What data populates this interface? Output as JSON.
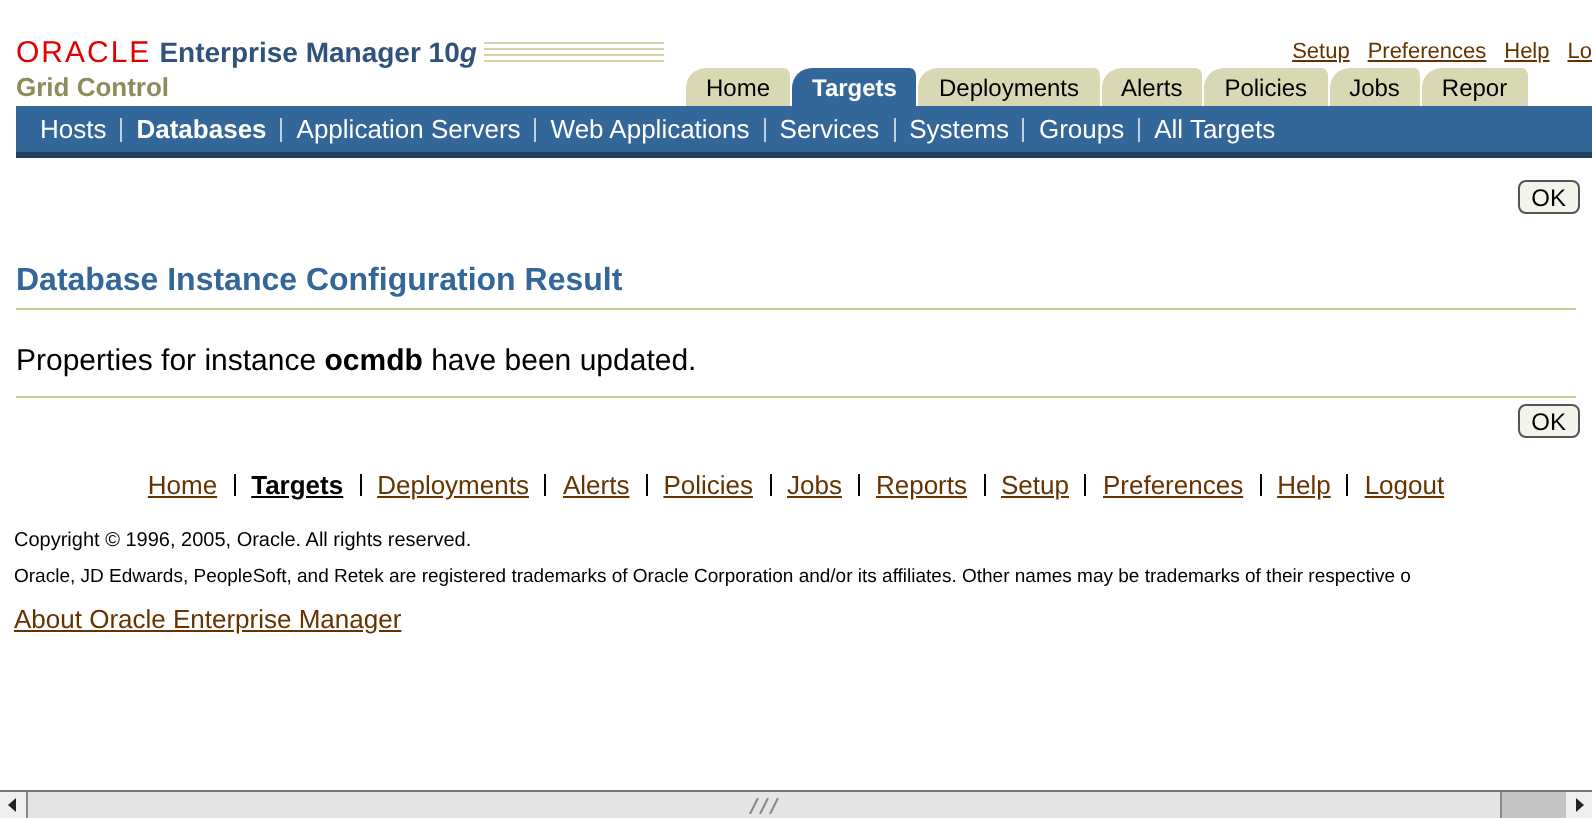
{
  "brand": {
    "logo": "ORACLE",
    "product": "Enterprise Manager 10",
    "product_suffix": "g",
    "subtitle": "Grid Control"
  },
  "global_links": [
    "Setup",
    "Preferences",
    "Help",
    "Lo"
  ],
  "tabs": [
    {
      "label": "Home",
      "selected": false
    },
    {
      "label": "Targets",
      "selected": true
    },
    {
      "label": "Deployments",
      "selected": false
    },
    {
      "label": "Alerts",
      "selected": false
    },
    {
      "label": "Policies",
      "selected": false
    },
    {
      "label": "Jobs",
      "selected": false
    },
    {
      "label": "Repor",
      "selected": false
    }
  ],
  "subtabs": [
    {
      "label": "Hosts",
      "selected": false
    },
    {
      "label": "Databases",
      "selected": true
    },
    {
      "label": "Application Servers",
      "selected": false
    },
    {
      "label": "Web Applications",
      "selected": false
    },
    {
      "label": "Services",
      "selected": false
    },
    {
      "label": "Systems",
      "selected": false
    },
    {
      "label": "Groups",
      "selected": false
    },
    {
      "label": "All Targets",
      "selected": false
    }
  ],
  "ok_buttons": [
    "OK",
    "OK"
  ],
  "heading": "Database Instance Configuration Result",
  "message": "Properties for instance **ocmdb** have been updated.",
  "footer_links": [
    {
      "label": "Home",
      "selected": false
    },
    {
      "label": "Targets",
      "selected": true
    },
    {
      "label": "Deployments",
      "selected": false
    },
    {
      "label": "Alerts",
      "selected": false
    },
    {
      "label": "Policies",
      "selected": false
    },
    {
      "label": "Jobs",
      "selected": false
    },
    {
      "label": "Reports",
      "selected": false
    },
    {
      "label": "Setup",
      "selected": false
    },
    {
      "label": "Preferences",
      "selected": false
    },
    {
      "label": "Help",
      "selected": false
    },
    {
      "label": "Logout",
      "selected": false
    }
  ],
  "copyright": "Copyright © 1996, 2005, Oracle. All rights reserved.",
  "trademark": "Oracle, JD Edwards, PeopleSoft, and Retek are registered trademarks of Oracle Corporation and/or its affiliates. Other names may be trademarks of their respective o",
  "about_link": "About Oracle Enterprise Manager"
}
